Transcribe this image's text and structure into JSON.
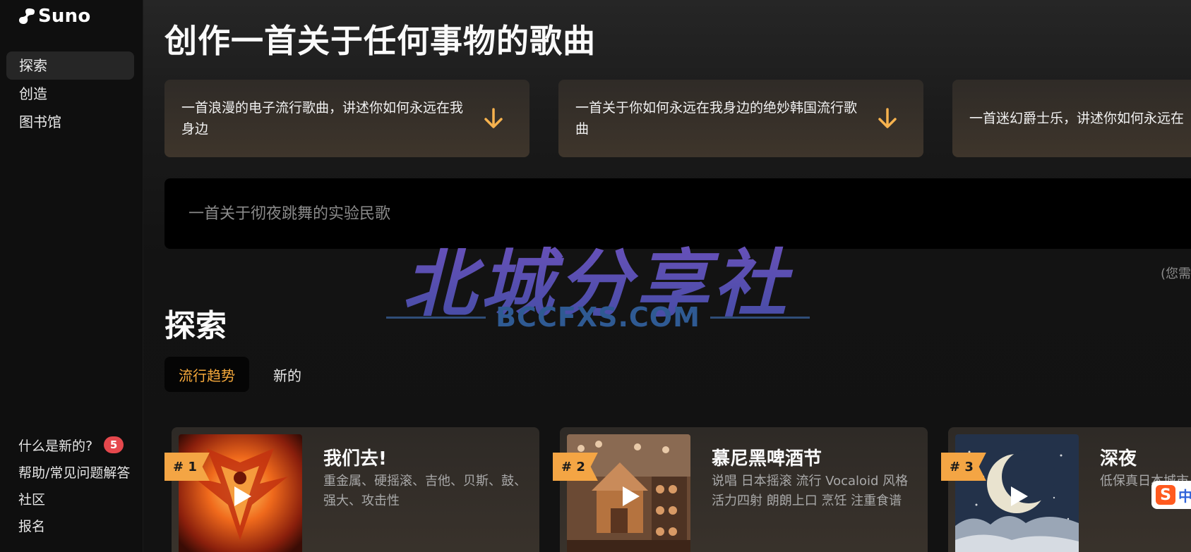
{
  "app": {
    "name": "Suno"
  },
  "sidebar": {
    "nav": [
      {
        "label": "探索",
        "active": true
      },
      {
        "label": "创造",
        "active": false
      },
      {
        "label": "图书馆",
        "active": false
      }
    ],
    "footer": {
      "whats_new": {
        "label": "什么是新的?",
        "badge": "5"
      },
      "help": "帮助/常见问题解答",
      "community": "社区",
      "signup": "报名"
    }
  },
  "hero": {
    "title": "创作一首关于任何事物的歌曲",
    "prompt_cards": [
      {
        "text": "一首浪漫的电子流行歌曲，讲述你如何永远在我身边"
      },
      {
        "text": "一首关于你如何永远在我身边的绝妙韩国流行歌曲"
      },
      {
        "text": "一首迷幻爵士乐，讲述你如何永远在"
      }
    ],
    "input_placeholder": "一首关于彻夜跳舞的实验民歌",
    "hint_text": "(您需"
  },
  "explore": {
    "title": "探索",
    "tabs": [
      {
        "label": "流行趋势",
        "active": true
      },
      {
        "label": "新的",
        "active": false
      }
    ],
    "songs": [
      {
        "rank": "# 1",
        "title": "我们去!",
        "tags": "重金属、硬摇滚、吉他、贝斯、鼓、强大、攻击性"
      },
      {
        "rank": "# 2",
        "title": "慕尼黑啤酒节",
        "tags": "说唱 日本摇滚 流行 Vocaloid 风格 活力四射 朗朗上口 烹饪 注重食谱"
      },
      {
        "rank": "# 3",
        "title": "深夜",
        "tags": "低保真日本城市"
      }
    ]
  },
  "watermark": {
    "main": "北城分享社",
    "sub": "BCCFXS.COM"
  },
  "ime": {
    "logo": "S",
    "mode": "中"
  },
  "colors": {
    "accent": "#f6a93b",
    "rank_tag": "#f4a544",
    "badge": "#e5484d",
    "card_bg": "#3a332c"
  }
}
